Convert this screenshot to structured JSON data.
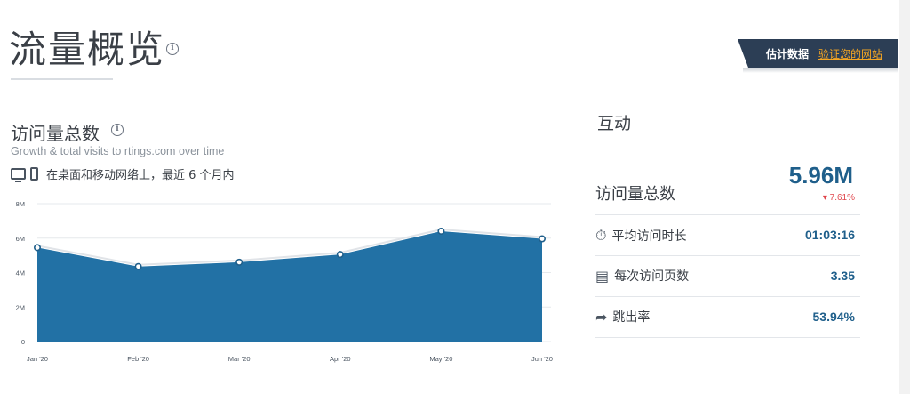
{
  "header": {
    "title": "流量概览",
    "info_icon": "ⓘ",
    "banner_label": "估计数据",
    "banner_link": "验证您的网站"
  },
  "visits": {
    "title": "访问量总数",
    "subtitle": "Growth & total visits to rtings.com over time",
    "device_note": "在桌面和移动网络上，最近 6 个月内"
  },
  "chart_data": {
    "type": "area",
    "x": [
      "Jan '20",
      "Feb '20",
      "Mar '20",
      "Apr '20",
      "May '20",
      "Jun '20"
    ],
    "values": [
      5.45,
      4.35,
      4.6,
      5.05,
      6.4,
      5.96
    ],
    "y_tick_labels": [
      "0",
      "2M",
      "4M",
      "6M",
      "8M"
    ],
    "ylim": [
      0,
      8
    ],
    "grid": true,
    "colors": {
      "fill": "#2271a5",
      "line": "#e1e4e8",
      "marker": "#ffffff"
    }
  },
  "engagement": {
    "title": "互动",
    "total_visits_label": "访问量总数",
    "total_visits_value": "5.96M",
    "total_visits_change": "7.61%",
    "avg_duration_label": "平均访问时长",
    "avg_duration_value": "01:03:16",
    "pages_per_visit_label": "每次访问页数",
    "pages_per_visit_value": "3.35",
    "bounce_rate_label": "跳出率",
    "bounce_rate_value": "53.94%"
  },
  "icons": {
    "timer": "⏱",
    "pages": "▤",
    "bounce": "➦",
    "down": "▾"
  }
}
